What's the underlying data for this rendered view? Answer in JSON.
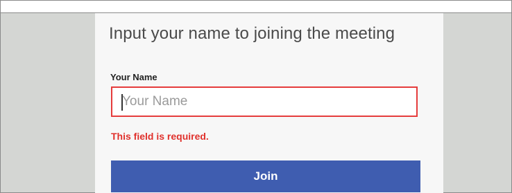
{
  "dialog": {
    "title": "Input your name to joining the meeting",
    "name_label": "Your Name",
    "name_input": {
      "value": "",
      "placeholder": "Your Name"
    },
    "error_message": "This field is required.",
    "join_label": "Join"
  },
  "colors": {
    "background": "#d4d6d3",
    "panel": "#f7f7f7",
    "error": "#e0312c",
    "input_border_error": "#e53b3b",
    "button": "#3f5db0"
  }
}
